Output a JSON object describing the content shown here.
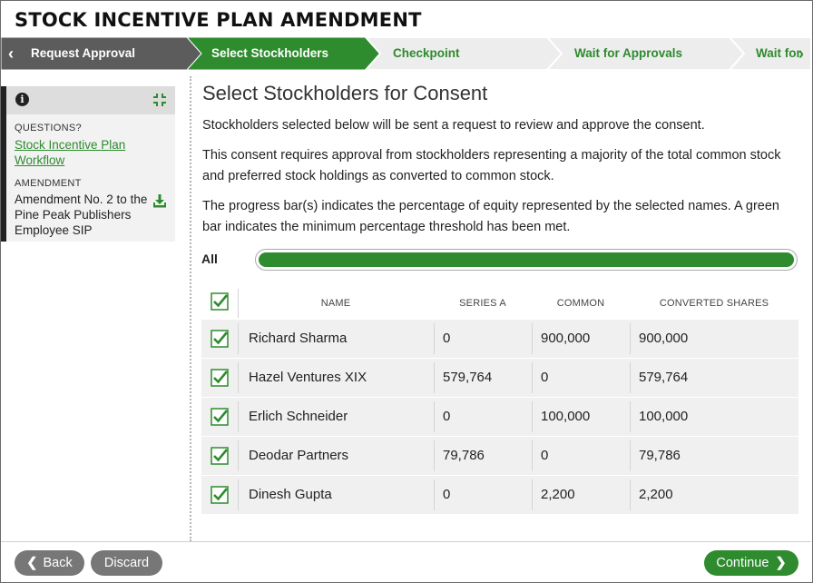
{
  "page": {
    "title": "STOCK INCENTIVE PLAN AMENDMENT"
  },
  "steps": [
    {
      "label": "Request Approval",
      "state": "done"
    },
    {
      "label": "Select Stockholders",
      "state": "active"
    },
    {
      "label": "Checkpoint",
      "state": "upcoming"
    },
    {
      "label": "Wait for Approvals",
      "state": "upcoming"
    },
    {
      "label": "Wait for",
      "state": "upcoming"
    }
  ],
  "sidebar": {
    "questions_label": "QUESTIONS?",
    "workflow_link": "Stock Incentive Plan Workflow",
    "amendment_label": "AMENDMENT",
    "amendment_name": "Amendment No. 2 to the Pine Peak Publishers Employee SIP"
  },
  "main": {
    "heading": "Select Stockholders for Consent",
    "paragraphs": [
      "Stockholders selected below will be sent a request to review and approve the consent.",
      "This consent requires approval from stockholders representing a majority of the total common stock and preferred stock holdings as converted to common stock.",
      "The progress bar(s) indicates the percentage of equity represented by the selected names. A green bar indicates the minimum percentage threshold has been met."
    ],
    "progress": {
      "label": "All",
      "value_percent": 100
    }
  },
  "table": {
    "headers": {
      "name": "NAME",
      "series_a": "SERIES A",
      "common": "COMMON",
      "converted": "CONVERTED SHARES"
    },
    "rows": [
      {
        "name": "Richard Sharma",
        "series_a": "0",
        "common": "900,000",
        "converted": "900,000",
        "checked": true
      },
      {
        "name": "Hazel Ventures XIX",
        "series_a": "579,764",
        "common": "0",
        "converted": "579,764",
        "checked": true
      },
      {
        "name": "Erlich Schneider",
        "series_a": "0",
        "common": "100,000",
        "converted": "100,000",
        "checked": true
      },
      {
        "name": "Deodar Partners",
        "series_a": "79,786",
        "common": "0",
        "converted": "79,786",
        "checked": true
      },
      {
        "name": "Dinesh Gupta",
        "series_a": "0",
        "common": "2,200",
        "converted": "2,200",
        "checked": true
      }
    ]
  },
  "footer": {
    "back": "Back",
    "discard": "Discard",
    "continue": "Continue"
  },
  "colors": {
    "accent": "#2e8b2e",
    "step_done": "#5c5c5c",
    "step_upcoming": "#ededed",
    "button_grey": "#777777"
  }
}
